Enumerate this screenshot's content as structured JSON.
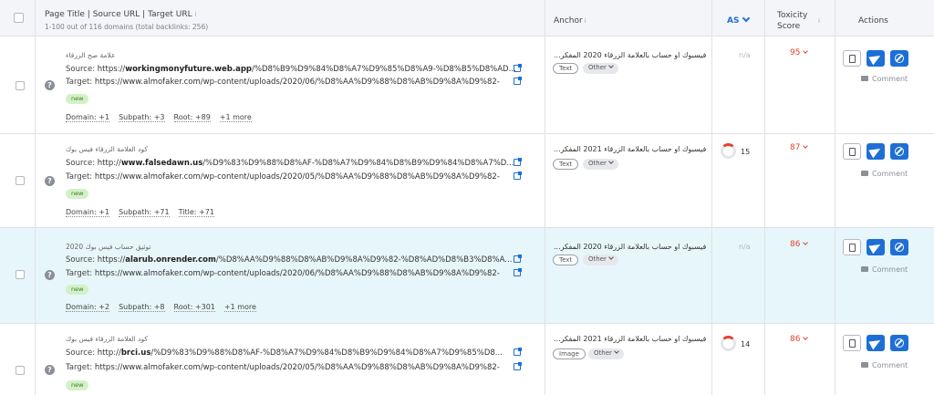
{
  "header": {
    "col_page": "Page Title | Source URL | Target URL",
    "col_page_info": "i",
    "col_page_sub": "1-100 out of 116 domains (total backlinks: 256)",
    "col_anchor": "Anchor",
    "col_anchor_info": "i",
    "col_as": "AS",
    "col_tox_1": "Toxicity",
    "col_tox_2": "Score",
    "col_tox_info": "i",
    "col_actions": "Actions"
  },
  "labels": {
    "source": "Source: ",
    "target": "Target: ",
    "new": "new",
    "comment": "Comment",
    "help": "?"
  },
  "rows": [
    {
      "title": "علامة صح الزرقاء",
      "source_prefix": "https://",
      "source_domain": "workingmonyfuture.web.app",
      "source_rest": "/%D8%B9%D9%84%D8%A7%D9%85%D8%A9-%D8%B5%D8%AD...",
      "target": "https://www.almofaker.com/wp-content/uploads/2020/06/%D8%AA%D9%88%D8%AB%D9%8A%D9%82-",
      "metrics": [
        "Domain: +1",
        "Subpath: +3",
        "Root: +89",
        "+1 more"
      ],
      "anchor": "...ء فيسبوك او حساب بالعلامة الزرقاء 2020 المفكر",
      "anchor_type": "Text",
      "anchor_cat": "Other",
      "as": "n/a",
      "toxicity": "95"
    },
    {
      "title": "كود العلامة الزرقاء فيس بوك",
      "source_prefix": "http://",
      "source_domain": "www.falsedawn.us",
      "source_rest": "/%D9%83%D9%88%D8%AF-%D8%A7%D9%84%D8%B9%D9%84%D8%A7%D...",
      "target": "https://www.almofaker.com/wp-content/uploads/2020/05/%D8%AA%D9%88%D8%AB%D9%8A%D9%82-",
      "metrics": [
        "Domain: +1",
        "Subpath: +71",
        "Title: +71"
      ],
      "anchor": "...ء فيسبوك او حساب بالعلامة الزرقاء 2021 المفكر",
      "anchor_type": "Text",
      "anchor_cat": "Other",
      "as": "15",
      "toxicity": "87"
    },
    {
      "title": "توثيق حساب فيس بوك 2020",
      "source_prefix": "https://",
      "source_domain": "alarub.onrender.com",
      "source_rest": "/%D8%AA%D9%88%D8%AB%D9%8A%D9%82-%D8%AD%D8%B3%D8%A...",
      "target": "https://www.almofaker.com/wp-content/uploads/2020/06/%D8%AA%D9%88%D8%AB%D9%8A%D9%82-",
      "metrics": [
        "Domain: +2",
        "Subpath: +8",
        "Root: +301",
        "+1 more"
      ],
      "anchor": "...ء فيسبوك او حساب بالعلامة الزرقاء 2020 المفكر",
      "anchor_type": "Text",
      "anchor_cat": "Other",
      "as": "n/a",
      "toxicity": "86"
    },
    {
      "title": "كود العلامة الزرقاء فيس بوك",
      "source_prefix": "http://",
      "source_domain": "brci.us",
      "source_rest": "/%D9%83%D9%88%D8%AF-%D8%A7%D9%84%D8%B9%D9%84%D8%A7%D9%85%D8...",
      "target": "https://www.almofaker.com/wp-content/uploads/2020/05/%D8%AA%D9%88%D8%AB%D9%8A%D9%82-",
      "metrics": [],
      "anchor": "...ء فيسبوك او حساب بالعلامة الزرقاء 2021 المفكر",
      "anchor_type": "Image",
      "anchor_cat": "Other",
      "as": "14",
      "toxicity": "86"
    }
  ]
}
